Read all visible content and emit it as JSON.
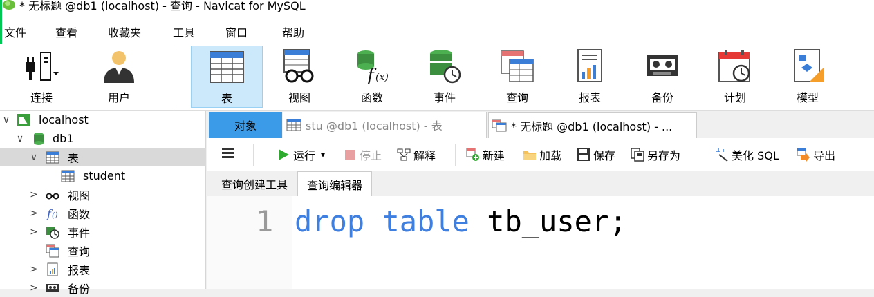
{
  "window": {
    "title": "* 无标题 @db1 (localhost) - 查询 - Navicat for MySQL"
  },
  "menu": [
    "文件",
    "查看",
    "收藏夹",
    "工具",
    "窗口",
    "帮助"
  ],
  "toolbar": {
    "connect": "连接",
    "user": "用户",
    "table": "表",
    "view": "视图",
    "function": "函数",
    "event": "事件",
    "query": "查询",
    "report": "报表",
    "backup": "备份",
    "schedule": "计划",
    "model": "模型"
  },
  "sidebar": {
    "items": [
      {
        "label": "localhost",
        "icon": "server-icon",
        "arrow": "∨"
      },
      {
        "label": "db1",
        "icon": "database-icon",
        "arrow": "∨"
      },
      {
        "label": "表",
        "icon": "table-icon",
        "arrow": "∨"
      },
      {
        "label": "student",
        "icon": "table-icon",
        "arrow": ""
      },
      {
        "label": "视图",
        "icon": "view-icon",
        "arrow": ">"
      },
      {
        "label": "函数",
        "icon": "function-icon",
        "arrow": ">"
      },
      {
        "label": "事件",
        "icon": "event-icon",
        "arrow": ">"
      },
      {
        "label": "查询",
        "icon": "query-icon",
        "arrow": ""
      },
      {
        "label": "报表",
        "icon": "report-icon",
        "arrow": ">"
      },
      {
        "label": "备份",
        "icon": "backup-icon",
        "arrow": ">"
      }
    ]
  },
  "tabs": {
    "objects": "对象",
    "tab2": "stu @db1 (localhost) - 表",
    "tab3": "* 无标题 @db1 (localhost) - ..."
  },
  "editor_toolbar": {
    "run": "运行",
    "stop": "停止",
    "explain": "解释",
    "new": "新建",
    "load": "加载",
    "save": "保存",
    "save_as": "另存为",
    "beautify": "美化 SQL",
    "export": "导出"
  },
  "subtabs": {
    "builder": "查询创建工具",
    "editor": "查询编辑器"
  },
  "editor": {
    "line_number": "1",
    "kw1": "drop",
    "kw2": "table",
    "rest": "tb_user;"
  },
  "colors": {
    "accent": "#3c9be8",
    "keyword": "#3f7fe0",
    "selected": "#cce8fb"
  }
}
